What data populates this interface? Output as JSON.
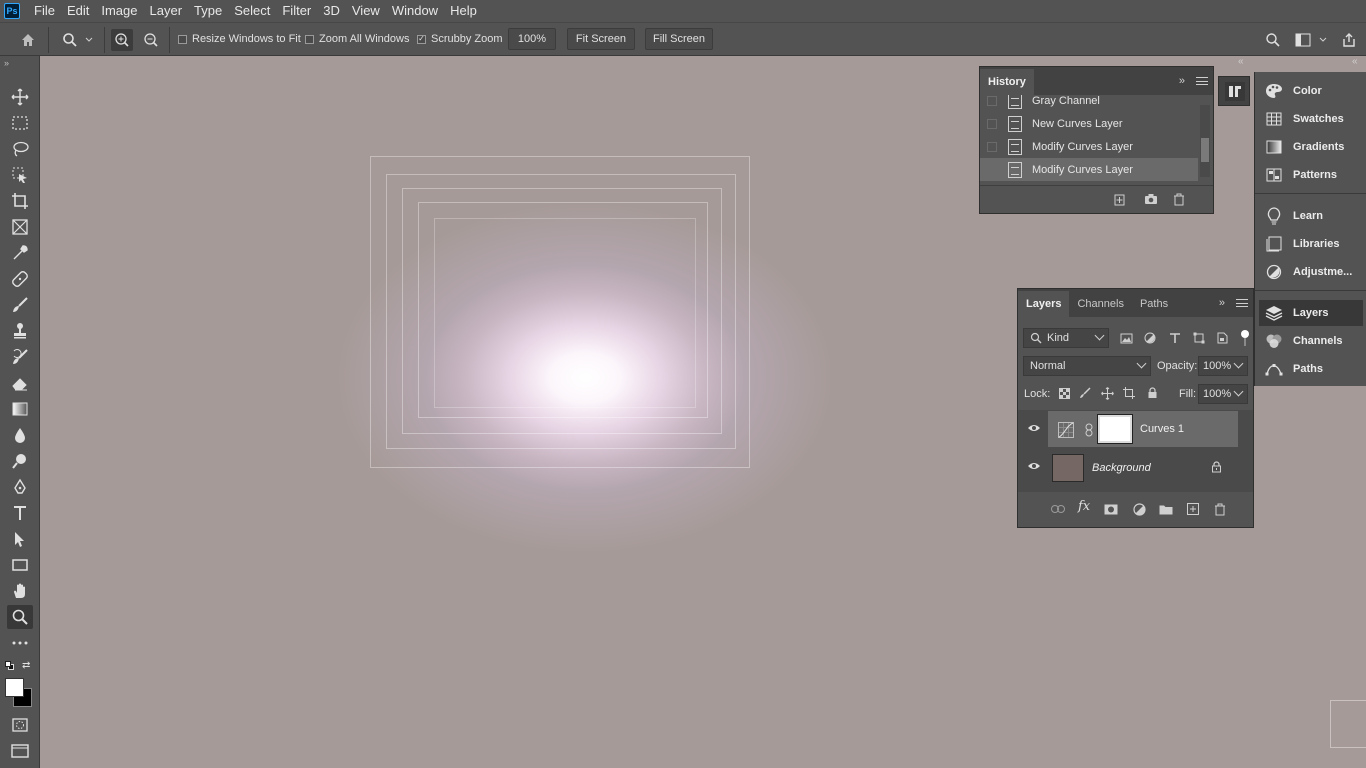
{
  "app": {
    "logo": "Ps"
  },
  "menu": [
    "File",
    "Edit",
    "Image",
    "Layer",
    "Type",
    "Select",
    "Filter",
    "3D",
    "View",
    "Window",
    "Help"
  ],
  "options": {
    "resize_windows": "Resize Windows to Fit",
    "zoom_all": "Zoom All Windows",
    "scrubby_zoom": "Scrubby Zoom",
    "zoom_value": "100%",
    "fit_screen": "Fit Screen",
    "fill_screen": "Fill Screen",
    "scrubby_checked": true
  },
  "history": {
    "title": "History",
    "cut_item": "Gray Channel",
    "items": [
      "New Curves Layer",
      "Modify Curves Layer",
      "Modify Curves Layer"
    ]
  },
  "dock": {
    "group1": [
      "Color",
      "Swatches",
      "Gradients",
      "Patterns"
    ],
    "group2": [
      "Learn",
      "Libraries",
      "Adjustme..."
    ],
    "group3": [
      "Layers",
      "Channels",
      "Paths"
    ]
  },
  "layers": {
    "tabs": [
      "Layers",
      "Channels",
      "Paths"
    ],
    "kind": "Kind",
    "blend_mode": "Normal",
    "opacity_label": "Opacity:",
    "opacity_value": "100%",
    "lock_label": "Lock:",
    "fill_label": "Fill:",
    "fill_value": "100%",
    "rows": [
      {
        "name": "Curves 1"
      },
      {
        "name": "Background"
      }
    ]
  },
  "colors": {
    "ui_bg": "#535353",
    "canvas": "#a69a98",
    "accent": "#31a8ff"
  }
}
